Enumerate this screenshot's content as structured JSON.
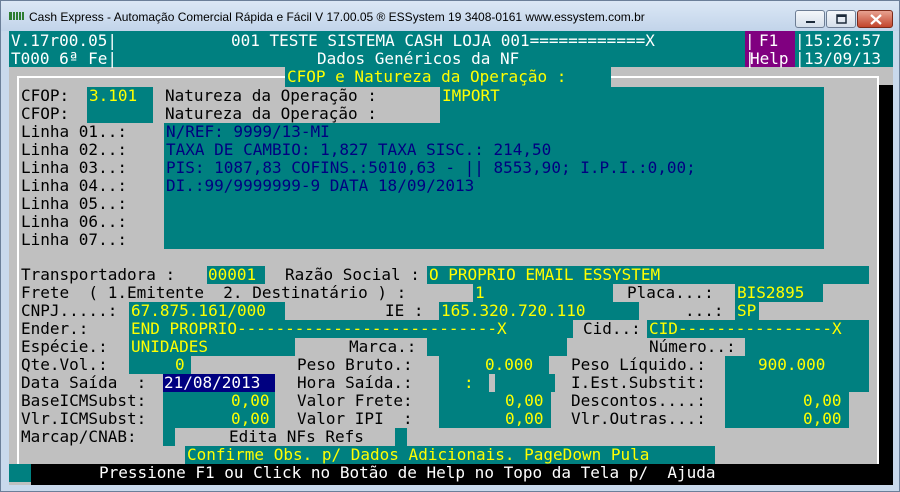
{
  "window": {
    "title": "Cash Express - Automação Comercial Rápida e Fácil V 17.00.05   ® ESSystem   19 3408-0161   www.essystem.com.br",
    "icon": "cash-express-app-icon"
  },
  "header": {
    "version": "V.17r00.05|",
    "system_line": "001 TESTE SISTEMA CASH LOJA 001============X",
    "f1_label": "F1",
    "help_label": "Help",
    "time": "15:26:57",
    "terminal": "T000 6ª Fe|",
    "screen_title": "Dados Genéricos da NF",
    "date": "13/09/13",
    "pipe": "|"
  },
  "cfop_panel": {
    "title": "CFOP e Natureza da Operação :",
    "cfop_label_1": "CFOP:",
    "cfop_value": "3.101",
    "natureza_label_1": "Natureza da Operação :",
    "natureza_value": "IMPORT",
    "cfop_label_2": "CFOP:",
    "natureza_label_2": "Natureza da Operação :",
    "lines": [
      {
        "label": "Linha 01..:",
        "value": "N/REF: 9999/13-MI"
      },
      {
        "label": "Linha 02..:",
        "value": "TAXA DE CAMBIO: 1,827 TAXA SISC.: 214,50"
      },
      {
        "label": "Linha 03..:",
        "value": "PIS: 1087,83 COFINS.:5010,63 - || 8553,90; I.P.I.:0,00;"
      },
      {
        "label": "Linha 04..:",
        "value": "DI.:99/9999999-9 DATA 18/09/2013"
      },
      {
        "label": "Linha 05..:",
        "value": ""
      },
      {
        "label": "Linha 06..:",
        "value": ""
      },
      {
        "label": "Linha 07..:",
        "value": ""
      }
    ]
  },
  "transport": {
    "transportadora_label": "Transportadora :",
    "transportadora_value": "00001",
    "razao_label": "Razão Social :",
    "razao_value": "O PROPRIO EMAIL ESSYSTEM",
    "frete_label": "Frete  ( 1.Emitente  2. Destinatário ) :",
    "frete_value": "1",
    "placa_label": "Placa...:",
    "placa_value": "BIS2895",
    "cnpj_label": "CNPJ.....:",
    "cnpj_value": "67.875.161/000",
    "ie_label": "IE :",
    "ie_value": "165.320.720.110",
    "uf_label": "...:",
    "uf_value": "SP",
    "ender_label": "Ender.:",
    "ender_value": "END PROPRIO---------------------------X",
    "cid_label": "Cid..:",
    "cid_value": "CID----------------X",
    "especie_label": "Espécie.:",
    "especie_value": "UNIDADES",
    "marca_label": "Marca.:",
    "numero_label": "Número..:",
    "qtevol_label": "Qte.Vol.:",
    "qtevol_value": "0",
    "peso_bruto_label": "Peso Bruto.:",
    "peso_bruto_value": "0.000",
    "peso_liquido_label": "Peso Líquido.:",
    "peso_liquido_value": "900.000",
    "data_saida_label": "Data Saída  :",
    "data_saida_value": "21/08/2013",
    "hora_saida_label": "Hora Saída.:",
    "hora_saida_value": ":",
    "iest_label": "I.Est.Substit:",
    "base_label": "BaseICMSubst:",
    "base_value": "0,00",
    "valor_frete_label": "Valor Frete:",
    "valor_frete_value": "0,00",
    "descontos_label": "Descontos....:",
    "descontos_value": "0,00",
    "vlr_icms_label": "Vlr.ICMSubst:",
    "vlr_icms_value": "0,00",
    "valor_ipi_label": "Valor IPI  :",
    "valor_ipi_value": "0,00",
    "vlr_outras_label": "Vlr.Outras...:",
    "vlr_outras_value": "0,00",
    "marcap_label": "Marcap/CNAB:",
    "edita_label": "Edita NFs Refs"
  },
  "footer": {
    "confirm": "Confirme Obs. p/ Dados Adicionais. PageDown Pula",
    "help": "Pressione F1 ou Click no Botão de Help no Topo da Tela p/  Ajuda"
  },
  "colors": {
    "field_bg": "#008080",
    "screen_bg": "#c0c0c0",
    "text_navy": "#000080",
    "text_yellow": "#ffff00",
    "help_bg": "#800080"
  }
}
